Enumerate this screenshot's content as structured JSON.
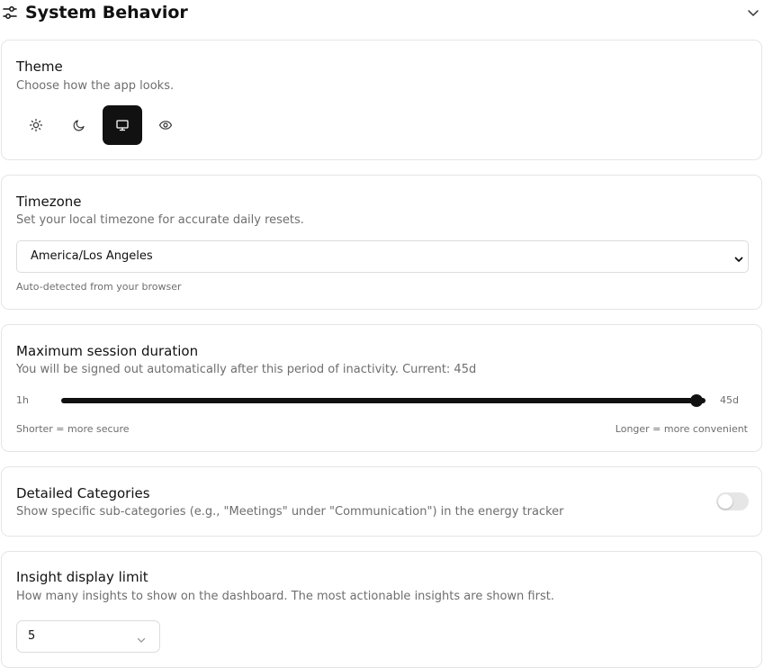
{
  "header": {
    "title": "System Behavior",
    "icon": "settings-sliders-icon",
    "collapse_icon": "chevron-down-icon"
  },
  "theme": {
    "title": "Theme",
    "description": "Choose how the app looks.",
    "options": [
      {
        "name": "light",
        "icon": "sun-icon"
      },
      {
        "name": "dark",
        "icon": "moon-icon"
      },
      {
        "name": "system",
        "icon": "monitor-icon"
      },
      {
        "name": "eye",
        "icon": "eye-icon"
      }
    ],
    "selected": "system"
  },
  "timezone": {
    "title": "Timezone",
    "description": "Set your local timezone for accurate daily resets.",
    "selected": "America/Los Angeles",
    "note": "Auto-detected from your browser"
  },
  "session": {
    "title": "Maximum session duration",
    "description": "You will be signed out automatically after this period of inactivity. Current: 45d",
    "min_label": "1h",
    "max_label": "45d",
    "value_fraction": 1.0,
    "left_hint": "Shorter = more secure",
    "right_hint": "Longer = more convenient"
  },
  "categories": {
    "title": "Detailed Categories",
    "description": "Show specific sub-categories (e.g., \"Meetings\" under \"Communication\") in the energy tracker",
    "enabled": false
  },
  "insights": {
    "title": "Insight display limit",
    "description": "How many insights to show on the dashboard. The most actionable insights are shown first.",
    "selected": "5"
  },
  "colors": {
    "primary": "#111111",
    "muted_text": "#6e6e6e",
    "border": "#e5e5e5",
    "track": "#e6e6e6"
  }
}
